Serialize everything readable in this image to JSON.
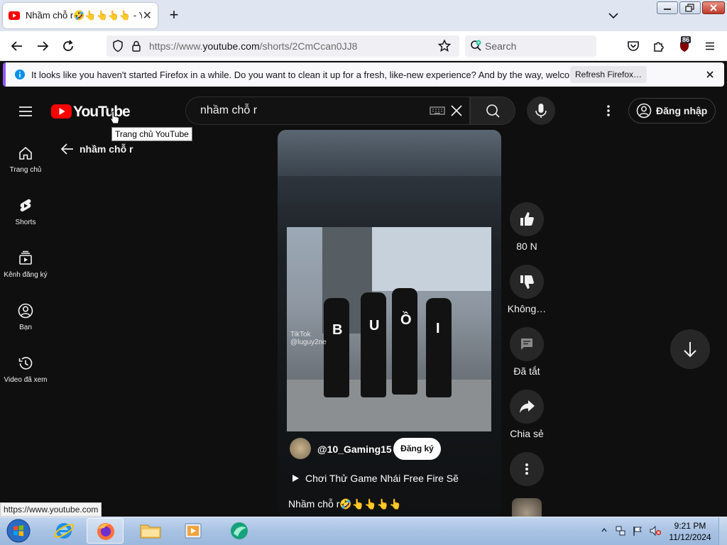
{
  "browser": {
    "tab": {
      "title": "Nhầm chỗ r🤣👆👆👆👆 - YouTube"
    },
    "url": {
      "prefix": "https://www.",
      "domain": "youtube.com",
      "path": "/shorts/2CmCcan0JJ8"
    },
    "search_placeholder": "Search",
    "extension_badge": "86",
    "notification": {
      "text": "It looks like you haven't started Firefox in a while. Do you want to clean it up for a fresh, like-new experience? And by the way, welcome back!",
      "button": "Refresh Firefox…"
    },
    "status_url": "https://www.youtube.com"
  },
  "youtube": {
    "logo_text": "YouTube",
    "tooltip": "Trang chủ YouTube",
    "search_value": "nhầm chỗ r",
    "signin_label": "Đăng nhập",
    "sidebar": [
      {
        "label": "Trang chủ",
        "icon": "home-icon"
      },
      {
        "label": "Shorts",
        "icon": "shorts-icon"
      },
      {
        "label": "Kênh đăng ký",
        "icon": "subscriptions-icon"
      },
      {
        "label": "Bạn",
        "icon": "account-icon"
      },
      {
        "label": "Video đã xem",
        "icon": "history-icon"
      }
    ],
    "back_label": "nhầm chỗ r",
    "short": {
      "watermark": "TikTok",
      "watermark_handle": "@luguy2ne",
      "shirt_letters": [
        "B",
        "U",
        "Ồ",
        "I"
      ],
      "channel": "@10_Gaming15",
      "subscribe": "Đăng ký",
      "video_title": "Chơi Thử Game Nhái Free Fire Sẽ",
      "caption": "Nhầm chỗ r🤣👆👆👆👆"
    },
    "actions": {
      "like": "80 N",
      "dislike": "Không…",
      "comments": "Đã tắt",
      "share": "Chia sẻ"
    }
  },
  "taskbar": {
    "time": "9:21 PM",
    "date": "11/12/2024"
  },
  "colors": {
    "yt_red": "#ff0000",
    "yt_bg": "#0f0f0f",
    "firefox_accent": "#9059ff"
  }
}
